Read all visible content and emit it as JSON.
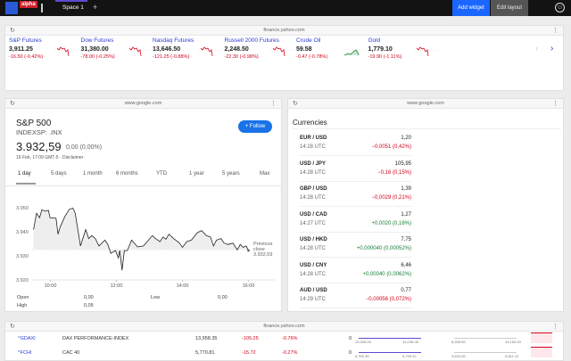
{
  "topbar": {
    "logo_text": "alpha",
    "tab": "Space 1",
    "add_tab": "+",
    "add_widget": "Add widget",
    "edit_layout": "Edit layout",
    "user_icon": "user-icon"
  },
  "ticker_widget": {
    "url": "finance.yahoo.com",
    "items": [
      {
        "name": "S&P Futures",
        "price": "3,911.25",
        "change": "-16.50 (-0.42%)",
        "dir": "down"
      },
      {
        "name": "Dow Futures",
        "price": "31,380.00",
        "change": "-78.00 (-0.25%)",
        "dir": "down"
      },
      {
        "name": "Nasdaq Futures",
        "price": "13,646.50",
        "change": "-121.25 (-0.88%)",
        "dir": "down"
      },
      {
        "name": "Russell 2000 Futures",
        "price": "2,248.50",
        "change": "-22.30 (-0.98%)",
        "dir": "down"
      },
      {
        "name": "Crude Oil",
        "price": "59.58",
        "change": "-0.47 (-0.78%)",
        "dir": "up"
      },
      {
        "name": "Gold",
        "price": "1,779.10",
        "change": "-19.90 (-1.11%)",
        "dir": "down"
      }
    ]
  },
  "sp_widget": {
    "url": "www.google.com",
    "title": "S&P 500",
    "symbol": "INDEXSP: .INX",
    "price": "3.932,59",
    "change": "0,00 (0,00%)",
    "date": "16 Feb, 17:09 GMT-5 · Disclaimer",
    "follow": "Follow",
    "ranges": [
      "1 day",
      "5 days",
      "1 month",
      "6 months",
      "YTD",
      "1 year",
      "5 years",
      "Max"
    ],
    "prev_close_label1": "Previous",
    "prev_close_label2": "close",
    "prev_close_value": "3.932,59",
    "stats": {
      "open_label": "Open",
      "open": "0,00",
      "high_label": "High",
      "high": "0,05",
      "low_label": "Low",
      "low": "0,00"
    }
  },
  "chart_data": {
    "type": "line",
    "title": "S&P 500 1 day",
    "xlabel": "",
    "ylabel": "",
    "ylim": [
      3920,
      3952
    ],
    "xlim": [
      9.5,
      16.8
    ],
    "yticks": [
      {
        "v": 3950,
        "label": "3.950"
      },
      {
        "v": 3940,
        "label": "3.940"
      },
      {
        "v": 3930,
        "label": "3.930"
      },
      {
        "v": 3920,
        "label": "3.920"
      }
    ],
    "xticks": [
      {
        "v": 10,
        "label": "10:00"
      },
      {
        "v": 12,
        "label": "12:00"
      },
      {
        "v": 14,
        "label": "14:00"
      },
      {
        "v": 16,
        "label": "16:00"
      }
    ],
    "previous_close": 3932.59,
    "x": [
      9.49,
      9.58,
      9.67,
      9.74,
      9.85,
      9.94,
      9.99,
      10.17,
      10.23,
      10.3,
      10.44,
      10.57,
      10.68,
      10.75,
      10.91,
      11.07,
      11.16,
      11.25,
      11.36,
      11.47,
      11.65,
      11.74,
      11.83,
      11.97,
      12.06,
      12.1,
      12.17,
      12.24,
      12.33,
      12.46,
      12.64,
      12.82,
      13.09,
      13.18,
      13.32,
      13.41,
      13.5,
      13.59,
      13.73,
      13.91,
      14.0,
      14.13,
      14.27,
      14.45,
      14.58,
      14.72,
      14.85,
      14.94,
      15.03,
      15.17,
      15.26,
      15.39,
      15.53,
      15.66,
      15.75,
      15.84,
      15.93,
      16.0
    ],
    "y": [
      3940.9,
      3947.7,
      3945.8,
      3949.1,
      3948.5,
      3948.9,
      3945.8,
      3945.6,
      3939.0,
      3942.1,
      3946.4,
      3949.3,
      3949.8,
      3947.7,
      3934.1,
      3940.9,
      3937.2,
      3938.4,
      3937.2,
      3934.1,
      3936.5,
      3934.7,
      3931.0,
      3932.2,
      3929.1,
      3932.2,
      3924.0,
      3932.2,
      3932.2,
      3936.5,
      3933.7,
      3934.1,
      3938.4,
      3937.2,
      3935.9,
      3937.8,
      3936.9,
      3939.0,
      3937.2,
      3935.3,
      3933.5,
      3935.9,
      3936.5,
      3939.6,
      3940.5,
      3938.4,
      3937.8,
      3934.1,
      3936.5,
      3937.2,
      3935.3,
      3934.7,
      3935.3,
      3932.5,
      3934.7,
      3933.5,
      3934.1,
      3932.2
    ]
  },
  "currencies": {
    "url": "www.google.com",
    "title": "Currencies",
    "rows": [
      {
        "pair": "EUR / USD",
        "time": "14:28 UTC",
        "value": "1,20",
        "change": "−0,0051 (0,42%)",
        "dir": "down"
      },
      {
        "pair": "USD / JPY",
        "time": "14:28 UTC",
        "value": "105,95",
        "change": "−0,16 (0,15%)",
        "dir": "down"
      },
      {
        "pair": "GBP / USD",
        "time": "14:28 UTC",
        "value": "1,39",
        "change": "−0,0029 (0,21%)",
        "dir": "down"
      },
      {
        "pair": "USD / CAD",
        "time": "14:27 UTC",
        "value": "1,27",
        "change": "+0,0020 (0,16%)",
        "dir": "up"
      },
      {
        "pair": "USD / HKD",
        "time": "14:28 UTC",
        "value": "7,75",
        "change": "+0,000040 (0,00052%)",
        "dir": "up"
      },
      {
        "pair": "USD / CNY",
        "time": "14:28 UTC",
        "value": "6,46",
        "change": "+0,00040 (0,0062%)",
        "dir": "up"
      },
      {
        "pair": "AUD / USD",
        "time": "14:29 UTC",
        "value": "0,77",
        "change": "−0,00056 (0,072%)",
        "dir": "down"
      }
    ]
  },
  "indices": {
    "url": "finance.yahoo.com",
    "rows": [
      {
        "symbol": "^GDAXI",
        "name": "DAX PERFORMANCE-INDEX",
        "price": "13,958.35",
        "change": "-105.25",
        "pct": "-0.76%",
        "vol": "0",
        "day_lo": "13,928.00",
        "day_hi": "14,035.06",
        "yr_lo": "8,255.65",
        "yr_hi": "14,169.49"
      },
      {
        "symbol": "^FCHI",
        "name": "CAC 40",
        "price": "5,770.81",
        "change": "-15.72",
        "pct": "-0.27%",
        "vol": "0",
        "day_lo": "5,762.35",
        "day_hi": "5,799.22",
        "yr_lo": "3,632.06",
        "yr_hi": "5,811.12"
      }
    ]
  }
}
